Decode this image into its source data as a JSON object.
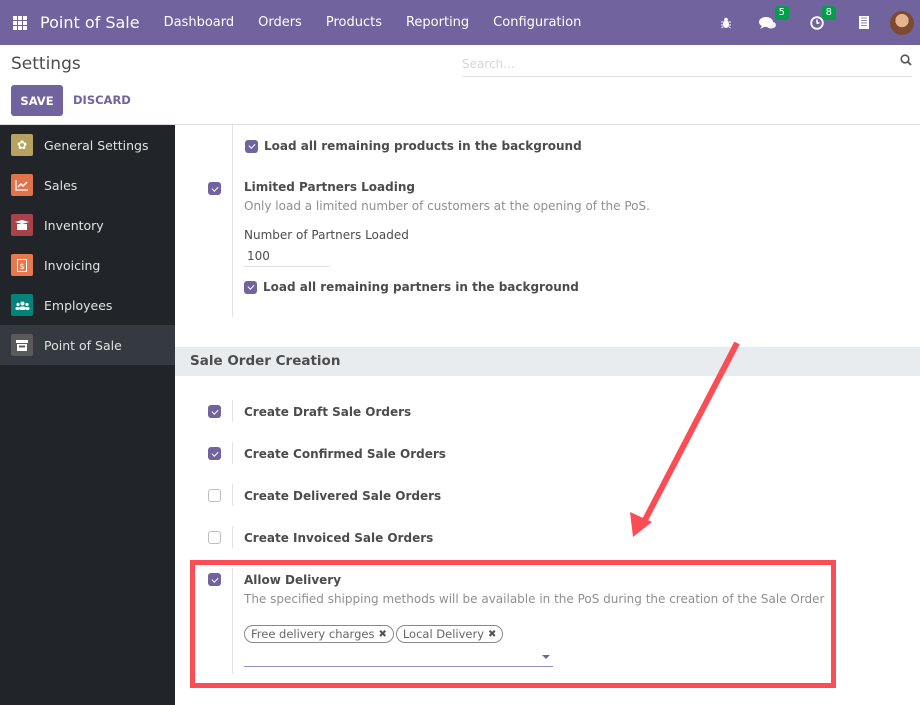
{
  "navbar": {
    "brand": "Point of Sale",
    "menu": [
      "Dashboard",
      "Orders",
      "Products",
      "Reporting",
      "Configuration"
    ],
    "messages_count": "5",
    "activities_count": "8",
    "bg_color": "#71639e"
  },
  "control_panel": {
    "title": "Settings",
    "save_label": "SAVE",
    "discard_label": "DISCARD",
    "search_placeholder": "Search..."
  },
  "sidebar": {
    "items": [
      {
        "label": "General Settings",
        "icon": "gear-icon",
        "color": "#b5a35f"
      },
      {
        "label": "Sales",
        "icon": "chart-line-icon",
        "color": "#e0744a"
      },
      {
        "label": "Inventory",
        "icon": "box-icon",
        "color": "#a8434b"
      },
      {
        "label": "Invoicing",
        "icon": "invoice-icon",
        "color": "#e57a4f"
      },
      {
        "label": "Employees",
        "icon": "users-icon",
        "color": "#03837a"
      },
      {
        "label": "Point of Sale",
        "icon": "store-icon",
        "color": "#5a5a5a",
        "active": true
      }
    ]
  },
  "settings": {
    "load_products_bg": {
      "label": "Load all remaining products in the background",
      "checked": true
    },
    "limited_partners": {
      "label": "Limited Partners Loading",
      "description": "Only load a limited number of customers at the opening of the PoS.",
      "checked": true,
      "field_label": "Number of Partners Loaded",
      "field_value": "100",
      "load_bg_label": "Load all remaining partners in the background",
      "load_bg_checked": true
    },
    "section_title": "Sale Order Creation",
    "sale_orders": [
      {
        "label": "Create Draft Sale Orders",
        "checked": true
      },
      {
        "label": "Create Confirmed Sale Orders",
        "checked": true
      },
      {
        "label": "Create Delivered Sale Orders",
        "checked": false
      },
      {
        "label": "Create Invoiced Sale Orders",
        "checked": false
      }
    ],
    "allow_delivery": {
      "label": "Allow Delivery",
      "description": "The specified shipping methods will be available in the PoS during the creation of the Sale Order",
      "checked": true,
      "tags": [
        "Free delivery charges",
        "Local Delivery"
      ]
    }
  },
  "annotation": {
    "color": "#fa4d56"
  }
}
